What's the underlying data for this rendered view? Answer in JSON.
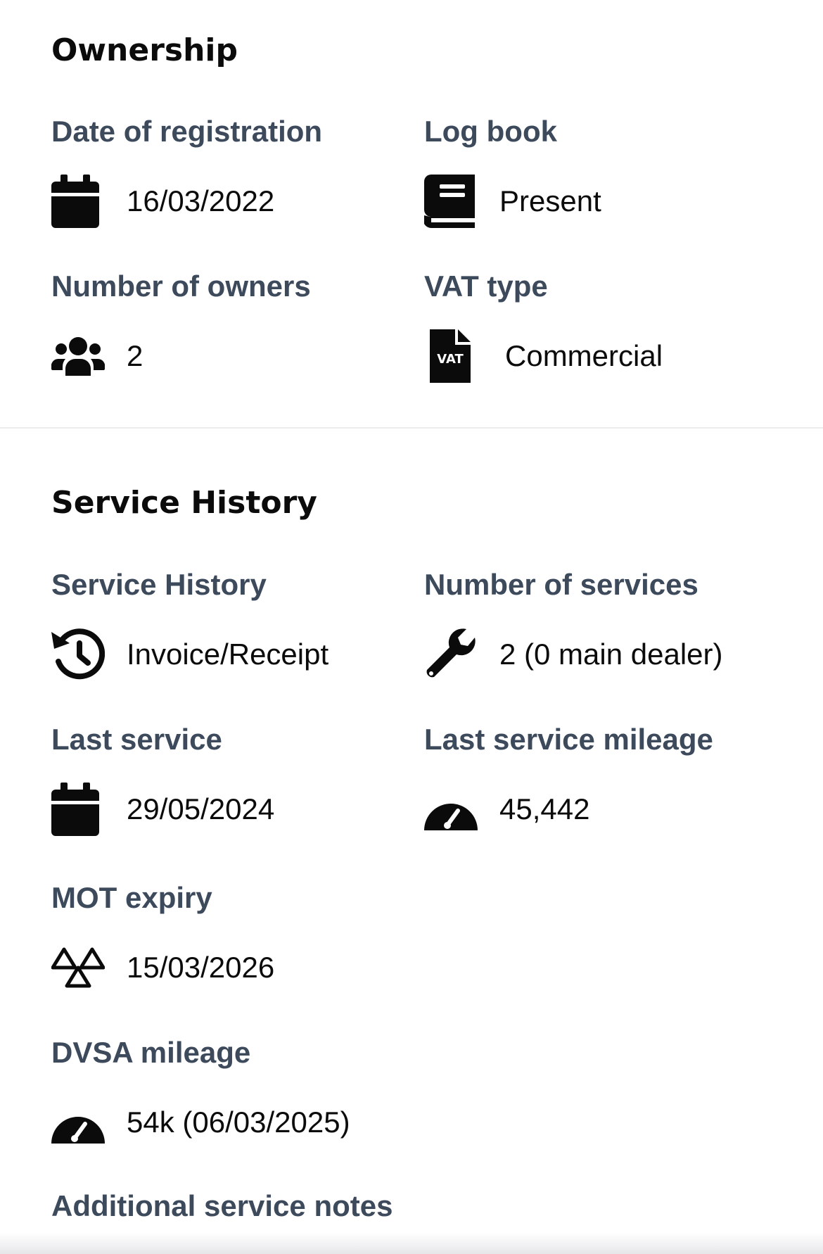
{
  "ownership": {
    "title": "Ownership",
    "fields": {
      "date_of_registration": {
        "label": "Date of registration",
        "value": "16/03/2022",
        "icon": "calendar-icon"
      },
      "log_book": {
        "label": "Log book",
        "value": "Present",
        "icon": "book-icon"
      },
      "number_of_owners": {
        "label": "Number of owners",
        "value": "2",
        "icon": "users-icon"
      },
      "vat_type": {
        "label": "VAT type",
        "value": "Commercial",
        "icon": "vat-document-icon"
      }
    }
  },
  "service_history": {
    "title": "Service History",
    "fields": {
      "service_history": {
        "label": "Service History",
        "value": "Invoice/Receipt",
        "icon": "history-icon"
      },
      "number_of_services": {
        "label": "Number of services",
        "value": "2 (0 main dealer)",
        "icon": "wrench-icon"
      },
      "last_service": {
        "label": "Last service",
        "value": "29/05/2024",
        "icon": "calendar-icon"
      },
      "last_service_mileage": {
        "label": "Last service mileage",
        "value": "45,442",
        "icon": "gauge-icon"
      },
      "mot_expiry": {
        "label": "MOT expiry",
        "value": "15/03/2026",
        "icon": "mot-triangles-icon"
      },
      "dvsa_mileage": {
        "label": "DVSA mileage",
        "value": "54k (06/03/2025)",
        "icon": "gauge-icon"
      },
      "additional_service_notes": {
        "label": "Additional service notes"
      }
    }
  },
  "colors": {
    "label": "#3d4a5c",
    "value": "#0b0b0c",
    "title": "#0b0b0c",
    "divider": "#ececef",
    "background": "#ffffff"
  }
}
